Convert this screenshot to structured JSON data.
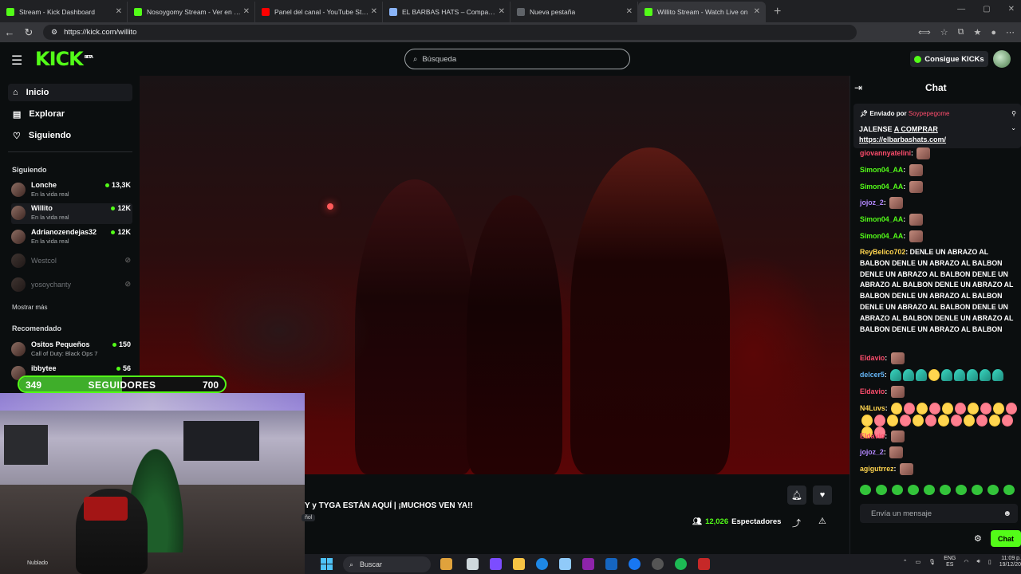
{
  "browser": {
    "tabs": [
      {
        "label": "Stream - Kick Dashboard",
        "favicon_color": "#53fc18"
      },
      {
        "label": "Nosoygomy Stream - Ver en direct",
        "favicon_color": "#53fc18"
      },
      {
        "label": "Panel del canal - YouTube Studio",
        "favicon_color": "#ff0000"
      },
      {
        "label": "EL BARBAS HATS – Compañía de s",
        "favicon_color": "#8ab4f8"
      },
      {
        "label": "Nueva pestaña",
        "favicon_color": "#8ab4f8"
      },
      {
        "label": "Willito Stream - Watch Live on",
        "favicon_color": "#53fc18"
      }
    ],
    "url": "https://kick.com/willito"
  },
  "header": {
    "logo": "KICK",
    "logo_badge": "BETA",
    "search_placeholder": "Búsqueda",
    "kicks_button": "Consigue KICKs"
  },
  "sidebar": {
    "nav": [
      {
        "label": "Inicio",
        "icon": "home-icon"
      },
      {
        "label": "Explorar",
        "icon": "browse-icon"
      },
      {
        "label": "Siguiendo",
        "icon": "heart-icon"
      }
    ],
    "following_title": "Siguiendo",
    "following": [
      {
        "name": "Lonche",
        "category": "En la vida real",
        "viewers": "13,3K"
      },
      {
        "name": "Willito",
        "category": "En la vida real",
        "viewers": "12K"
      },
      {
        "name": "Adrianozendejas32",
        "category": "En la vida real",
        "viewers": "12K"
      },
      {
        "name": "Westcol",
        "category": "",
        "viewers": ""
      },
      {
        "name": "yosoychanty",
        "category": "",
        "viewers": ""
      }
    ],
    "show_more": "Mostrar más",
    "recommended_title": "Recomendado",
    "recommended": [
      {
        "name": "Ositos Pequeños",
        "category": "Call of Duty: Black Ops 7",
        "viewers": "150"
      },
      {
        "name": "ibbytee",
        "category": "",
        "viewers": "56"
      }
    ]
  },
  "overlay": {
    "followers_current": "349",
    "followers_label": "SEGUIDORES",
    "followers_goal": "700",
    "progress_fraction": 0.5
  },
  "stream": {
    "title": "Y y TYGA ESTÁN AQUÍ | ¡MUCHOS VEN YA!!",
    "language_tag": "ñol",
    "viewers": "12,026",
    "viewers_label": "Espectadores"
  },
  "chat": {
    "title": "Chat",
    "pinned_by_label": "Enviado por",
    "pinned_by_user": "Soypepegome",
    "pinned_message": "JALENSE",
    "pinned_link_label": "A COMPRAR",
    "pinned_url": "https://elbarbashats.com/",
    "messages": [
      {
        "user": "giovannyatelini",
        "color": "#ff4d6d",
        "text": "",
        "emotes": 1
      },
      {
        "user": "Simon04_AA",
        "color": "#53fc18",
        "text": "",
        "emotes": 1
      },
      {
        "user": "Simon04_AA",
        "color": "#53fc18",
        "text": "",
        "emotes": 1
      },
      {
        "user": "jojoz_2",
        "color": "#b388ff",
        "text": "",
        "emotes": 1
      },
      {
        "user": "Simon04_AA",
        "color": "#53fc18",
        "text": "",
        "emotes": 1
      },
      {
        "user": "Simon04_AA",
        "color": "#53fc18",
        "text": "",
        "emotes": 1
      },
      {
        "user": "ReyBelico702",
        "color": "#ffd54f",
        "text": "DENLE UN ABRAZO AL BALBON DENLE UN ABRAZO AL BALBON DENLE UN ABRAZO AL BALBON DENLE UN ABRAZO AL BALBON DENLE UN ABRAZO AL BALBON DENLE UN ABRAZO AL BALBON DENLE UN ABRAZO AL BALBON DENLE UN ABRAZO AL BALBON DENLE UN ABRAZO AL BALBON DENLE UN ABRAZO AL BALBON",
        "emotes": 0
      },
      {
        "user": "Eldavio",
        "color": "#ff4d6d",
        "text": "",
        "emotes": 1
      },
      {
        "user": "delcer5",
        "color": "#64b5f6",
        "text": "",
        "emotes": 0
      },
      {
        "user": "Eldavio",
        "color": "#ff4d6d",
        "text": "",
        "emotes": 1
      },
      {
        "user": "N4Luvs",
        "color": "#ffd54f",
        "text": "",
        "emotes": 0
      },
      {
        "user": "Eldavio",
        "color": "#ff4d6d",
        "text": "",
        "emotes": 1
      },
      {
        "user": "jojoz_2",
        "color": "#b388ff",
        "text": "",
        "emotes": 1
      },
      {
        "user": "agigutrrez",
        "color": "#ffd54f",
        "text": "",
        "emotes": 1
      }
    ],
    "input_placeholder": "Envía un mensaje",
    "send_label": "Chat"
  },
  "taskbar": {
    "search_label": "Buscar",
    "lang": "ENG",
    "lang_sub": "ES",
    "time": "11:09 p.",
    "date": "19/12/20",
    "weather": "Nublado"
  },
  "colors": {
    "accent": "#53fc18",
    "bg": "#0b0e0f",
    "panel": "#191b1f"
  }
}
